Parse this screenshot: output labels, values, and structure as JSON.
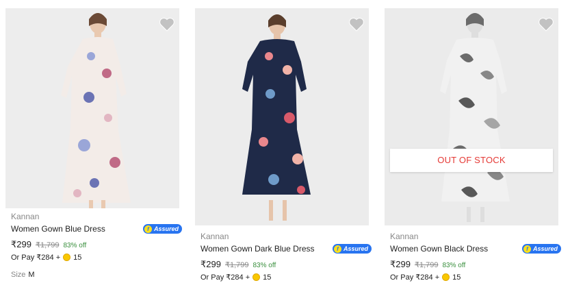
{
  "products": [
    {
      "brand": "Kannan",
      "title": "Women Gown Blue Dress",
      "assured_label": "Assured",
      "price": "₹299",
      "mrp": "₹1,799",
      "discount": "83% off",
      "or_pay": "Or Pay ₹284 +",
      "coins": "15",
      "size_label": "Size",
      "size_value": "M",
      "dress_color": "#f3ece8",
      "flower_colors": [
        "#9aa6d8",
        "#c06a86",
        "#6b73b4",
        "#e2b6c2"
      ]
    },
    {
      "brand": "Kannan",
      "title": "Women Gown Dark Blue Dress",
      "assured_label": "Assured",
      "price": "₹299",
      "mrp": "₹1,799",
      "discount": "83% off",
      "or_pay": "Or Pay ₹284 +",
      "coins": "15",
      "dress_color": "#1f2a48",
      "flower_colors": [
        "#e9878c",
        "#f1b3a8",
        "#6f9bc9",
        "#d85a6a"
      ]
    },
    {
      "brand": "Kannan",
      "title": "Women Gown Black Dress",
      "assured_label": "Assured",
      "price": "₹299",
      "mrp": "₹1,799",
      "discount": "83% off",
      "or_pay": "Or Pay ₹284 +",
      "coins": "15",
      "stock_status": "OUT OF STOCK",
      "dress_color": "#f2f2f2",
      "flower_colors": [
        "#555555",
        "#777777",
        "#3f3f3f",
        "#999999"
      ]
    }
  ],
  "icons": {
    "wishlist": "heart-icon",
    "assured": "flipkart-assured-badge",
    "coin": "supercoin-icon"
  },
  "colors": {
    "accent": "#2874f0",
    "discount": "#388e3c",
    "out_of_stock": "#e53935"
  }
}
